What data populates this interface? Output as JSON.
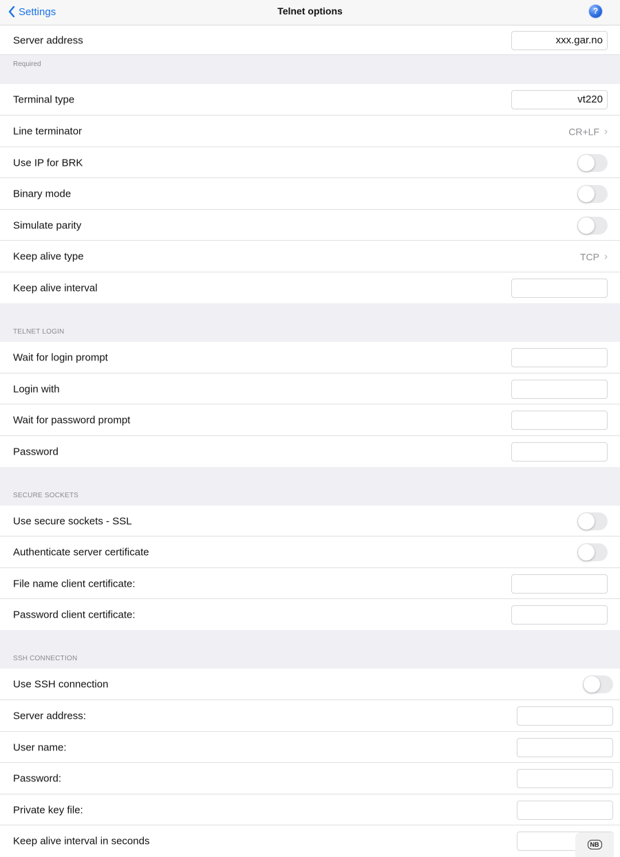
{
  "nav": {
    "back_label": "Settings",
    "title": "Telnet options",
    "help_icon": "?"
  },
  "server": {
    "label": "Server address",
    "value": "xxx.gar.no",
    "footnote": "Required"
  },
  "options": {
    "terminal_type": {
      "label": "Terminal type",
      "value": "vt220"
    },
    "line_terminator": {
      "label": "Line terminator",
      "value": "CR+LF"
    },
    "use_ip_for_brk": {
      "label": "Use IP for BRK",
      "on": false
    },
    "binary_mode": {
      "label": "Binary mode",
      "on": false
    },
    "simulate_parity": {
      "label": "Simulate parity",
      "on": false
    },
    "keep_alive_type": {
      "label": "Keep alive type",
      "value": "TCP"
    },
    "keep_alive_interval": {
      "label": "Keep alive interval",
      "value": ""
    }
  },
  "telnet_login": {
    "header": "TELNET LOGIN",
    "wait_login_prompt": {
      "label": "Wait for login prompt",
      "value": ""
    },
    "login_with": {
      "label": "Login with",
      "value": ""
    },
    "wait_password_prompt": {
      "label": "Wait for password prompt",
      "value": ""
    },
    "password": {
      "label": "Password",
      "value": ""
    }
  },
  "secure_sockets": {
    "header": "SECURE SOCKETS",
    "use_ssl": {
      "label": "Use secure sockets - SSL",
      "on": false
    },
    "authenticate_cert": {
      "label": "Authenticate server certificate",
      "on": false
    },
    "client_cert_file": {
      "label": "File name client certificate:",
      "value": ""
    },
    "client_cert_password": {
      "label": "Password client certificate:",
      "value": ""
    }
  },
  "ssh": {
    "header": "SSH CONNECTION",
    "use_ssh": {
      "label": "Use SSH connection",
      "on": false
    },
    "server_address": {
      "label": "Server address:",
      "value": ""
    },
    "user_name": {
      "label": "User name:",
      "value": ""
    },
    "password": {
      "label": "Password:",
      "value": ""
    },
    "private_key_file": {
      "label": "Private key file:",
      "value": ""
    },
    "keep_alive_seconds": {
      "label": "Keep alive interval in seconds",
      "value": ""
    }
  },
  "badge": {
    "label": "NB"
  },
  "colors": {
    "accent": "#1a73e8",
    "group_background": "#efeff4",
    "toggle_off": "#e9e9eb"
  }
}
